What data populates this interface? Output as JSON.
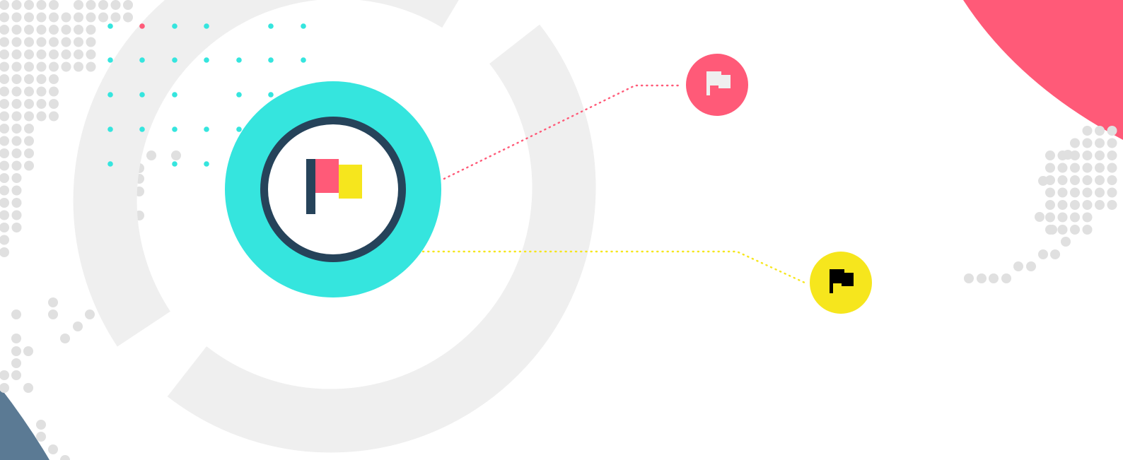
{
  "illustration": {
    "colors": {
      "background": "#ffffff",
      "ring_gray": "#efefef",
      "dot_gray": "#e0e0e0",
      "turquoise": "#35e5de",
      "navy": "#26435a",
      "pink": "#ff5a78",
      "yellow": "#f6e61d",
      "slate_blue": "#5b7a94",
      "badge_flag_light": "#efefef",
      "badge_flag_dark": "#000000"
    },
    "icons": {
      "central": "flag-icon",
      "pink_badge": "white-flag-icon",
      "yellow_badge": "black-flag-icon"
    }
  }
}
